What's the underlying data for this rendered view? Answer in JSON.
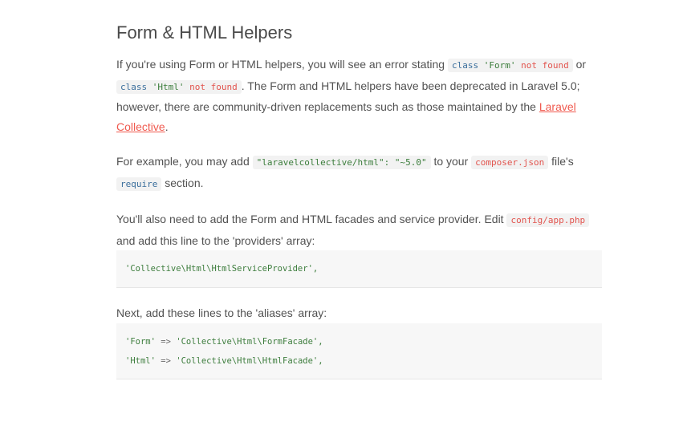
{
  "section": {
    "title": "Form & HTML Helpers"
  },
  "para1": {
    "text_a": "If you're using Form or HTML helpers, you will see an error stating ",
    "code1_kw": "class",
    "code1_str": "'Form'",
    "code1_err": "not found",
    "text_b": " or ",
    "code2_kw": "class",
    "code2_str": "'Html'",
    "code2_err": "not found",
    "text_c": ". The Form and HTML helpers have been deprecated in Laravel 5.0; however, there are community-driven replacements such as those maintained by the ",
    "link": "Laravel Collective",
    "text_d": "."
  },
  "para2": {
    "text_a": "For example, you may add ",
    "code1": "\"laravelcollective/html\": \"~5.0\"",
    "text_b": " to your ",
    "code2": "composer.json",
    "text_c": " file's ",
    "code3": "require",
    "text_d": " section."
  },
  "para3": {
    "text_a": "You'll also need to add the Form and HTML facades and service provider. Edit ",
    "code1": "config/app.php",
    "text_b": " and add this line to the 'providers' array:"
  },
  "code_block1": {
    "line1": "'Collective\\Html\\HtmlServiceProvider',"
  },
  "para4": {
    "text": "Next, add these lines to the 'aliases' array:"
  },
  "code_block2": {
    "line1_key": "'Form'",
    "line1_op": "=>",
    "line1_val": "'Collective\\Html\\FormFacade',",
    "line2_key": "'Html'",
    "line2_op": "=>",
    "line2_val": "'Collective\\Html\\HtmlFacade',"
  },
  "colors": {
    "link": "#f05a4f",
    "code_error": "#e2544e",
    "code_string": "#3b7d3b",
    "code_keyword": "#3a6e9c"
  }
}
